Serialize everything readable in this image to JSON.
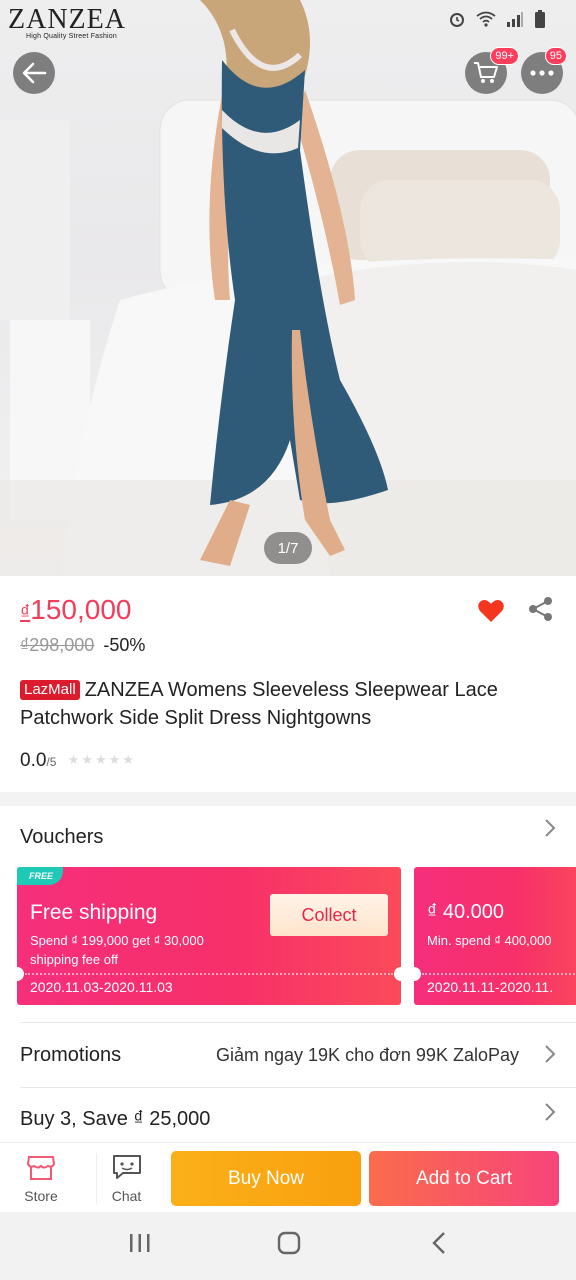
{
  "status": {
    "brand_name": "ZANZEA",
    "brand_tagline": "High Quality Street Fashion",
    "icons": [
      "alarm-icon",
      "wifi-icon",
      "signal-icon",
      "battery-icon"
    ]
  },
  "header": {
    "cart_badge": "99+",
    "more_badge": "95"
  },
  "gallery": {
    "counter": "1/7"
  },
  "product": {
    "currency": "₫",
    "price": "150,000",
    "old_price": "₫298,000",
    "discount": "-50%",
    "lazmall_label": "LazMall",
    "title": "ZANZEA Womens Sleeveless Sleepwear Lace Patchwork Side Split Dress Nightgowns",
    "rating": "0.0",
    "rating_max": "/5",
    "stars": "★★★★★"
  },
  "vouchers": {
    "title": "Vouchers",
    "items": [
      {
        "tag": "FREE",
        "title": "Free shipping",
        "desc": "Spend ₫ 199,000 get ₫ 30,000 shipping fee off",
        "date": "2020.11.03-2020.11.03",
        "action": "Collect"
      },
      {
        "title": "₫ 40.000",
        "desc": "Min. spend ₫ 400,000",
        "date": "2020.11.11-2020.11."
      }
    ]
  },
  "promotions": {
    "title": "Promotions",
    "text": "Giảm ngay 19K cho đơn 99K ZaloPay"
  },
  "bundle": {
    "title": "Buy 3, Save ₫ 25,000"
  },
  "bottom_bar": {
    "store_label": "Store",
    "chat_label": "Chat",
    "buy_now": "Buy Now",
    "add_to_cart": "Add to Cart"
  },
  "colors": {
    "price_red": "#f23c5a",
    "voucher_pink": "#f52f7b",
    "buy_now_orange": "#fbb018",
    "add_to_cart_pink": "#f7447a",
    "lazmall_red": "#dc1b2c",
    "free_tag_teal": "#1ec9b7"
  }
}
